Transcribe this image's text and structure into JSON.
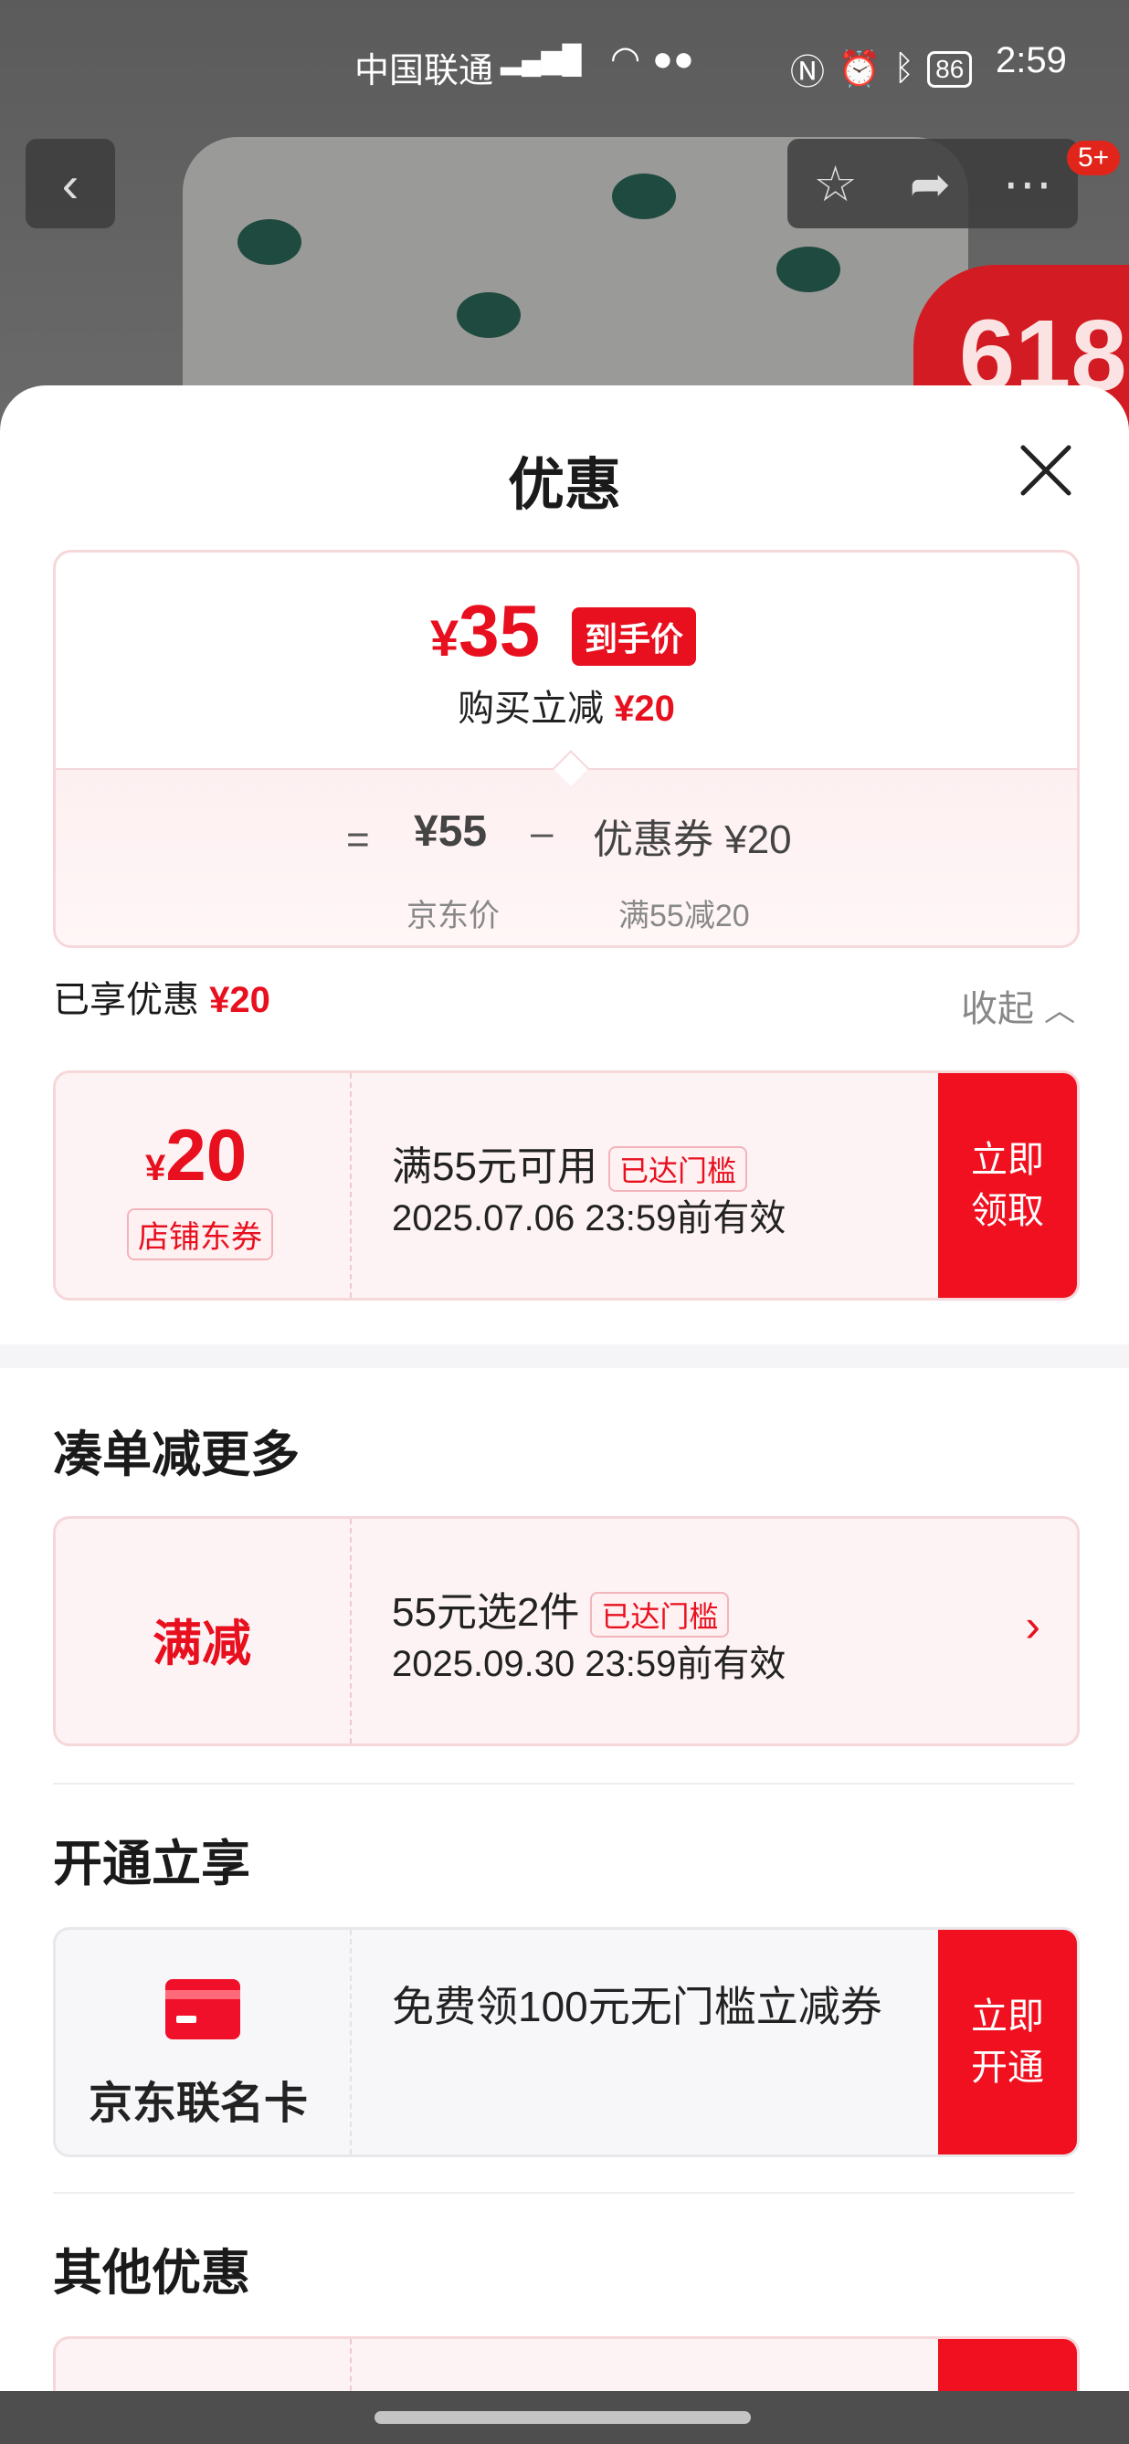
{
  "status_bar": {
    "carrier": "中国联通",
    "battery": "86",
    "time": "2:59"
  },
  "background": {
    "promo": "618",
    "notification_badge": "5+"
  },
  "sheet": {
    "title": "优惠",
    "price_summary": {
      "price_yen": "¥",
      "price_value": "35",
      "price_tag": "到手价",
      "instant_reduce_label": "购买立减",
      "instant_reduce_value": "¥20",
      "equals": "=",
      "jd_price": "¥55",
      "jd_price_label": "京东价",
      "minus": "–",
      "coupon_text": "优惠券 ¥20",
      "coupon_label": "满55减20"
    },
    "enjoyed": {
      "label": "已享优惠",
      "value": "¥20",
      "collapse_label": "收起"
    },
    "shop_coupon": {
      "yen": "¥",
      "amount": "20",
      "type_label": "店铺东券",
      "condition": "满55元可用",
      "reached": "已达门槛",
      "validity": "2025.07.06 23:59前有效",
      "cta": "立即领取"
    },
    "bundle_section": {
      "title": "凑单减更多",
      "promo_type": "满减",
      "condition": "55元选2件",
      "reached": "已达门槛",
      "validity": "2025.09.30 23:59前有效"
    },
    "open_section": {
      "title": "开通立享",
      "card_name": "京东联名卡",
      "description": "免费领100元无门槛立减券",
      "cta": "立即开通"
    },
    "other_section": {
      "title": "其他优惠"
    }
  },
  "colors": {
    "accent_red": "#e8101f",
    "cta_red": "#f0101f"
  }
}
